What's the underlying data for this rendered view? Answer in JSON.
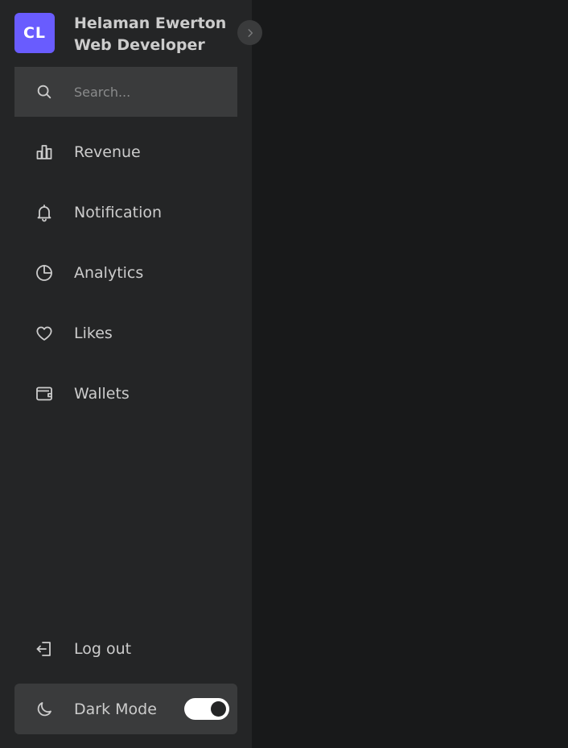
{
  "header": {
    "logo_text": "CL",
    "user_name": "Helaman Ewerton",
    "user_role": "Web Developer"
  },
  "search": {
    "placeholder": "Search...",
    "icon": "search-icon"
  },
  "menu": {
    "items": [
      {
        "label": "Revenue",
        "icon": "bar-chart-icon"
      },
      {
        "label": "Notification",
        "icon": "bell-icon"
      },
      {
        "label": "Analytics",
        "icon": "pie-chart-icon"
      },
      {
        "label": "Likes",
        "icon": "heart-icon"
      },
      {
        "label": "Wallets",
        "icon": "wallet-icon"
      }
    ]
  },
  "footer": {
    "logout_label": "Log out",
    "dark_mode_label": "Dark Mode",
    "dark_mode_enabled": true
  },
  "colors": {
    "sidebar_bg": "#242526",
    "page_bg": "#18191a",
    "accent": "#695cfe",
    "text": "#cccccc",
    "input_bg": "#3a3b3c"
  }
}
